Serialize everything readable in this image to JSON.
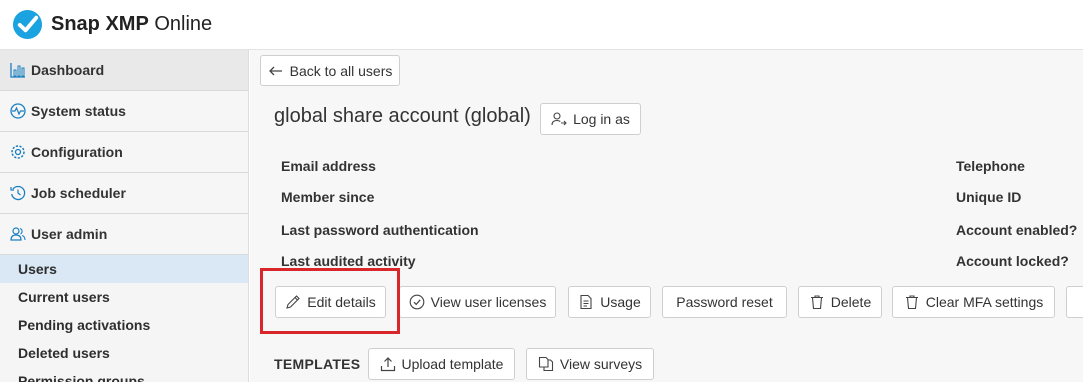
{
  "app": {
    "title_bold": "Snap XMP",
    "title_rest": " Online"
  },
  "sidebar": {
    "nav": [
      {
        "label": "Dashboard",
        "icon": "bar-chart-icon"
      },
      {
        "label": "System status",
        "icon": "heartbeat-icon"
      },
      {
        "label": "Configuration",
        "icon": "gear-icon"
      },
      {
        "label": "Job scheduler",
        "icon": "clock-history-icon"
      },
      {
        "label": "User admin",
        "icon": "users-icon"
      }
    ],
    "sub_items": [
      "Users",
      "Current users",
      "Pending activations",
      "Deleted users",
      "Permission groups"
    ]
  },
  "main": {
    "back_button": "Back to all users",
    "account_title": "global share account (global)",
    "login_button": "Log in as",
    "fields_left": [
      "Email address",
      "Member since",
      "Last password authentication",
      "Last audited activity"
    ],
    "fields_right": [
      "Telephone",
      "Unique ID",
      "Account enabled?",
      "Account locked?"
    ],
    "actions": {
      "edit": "Edit details",
      "licenses": "View user licenses",
      "usage": "Usage",
      "password_reset": "Password reset",
      "delete": "Delete",
      "clear_mfa": "Clear MFA settings"
    },
    "templates_label": "TEMPLATES",
    "upload_template": "Upload template",
    "view_surveys": "View surveys"
  },
  "colors": {
    "accent": "#1aa3e0",
    "highlight": "#d9262b",
    "active_sub": "#d9e8f4"
  }
}
